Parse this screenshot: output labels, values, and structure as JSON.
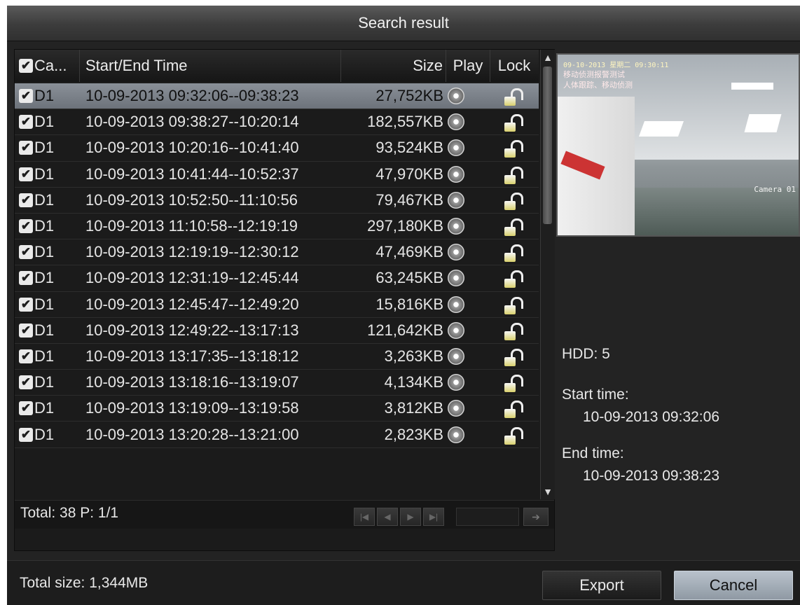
{
  "window": {
    "title": "Search result"
  },
  "table": {
    "headers": {
      "camera": "Ca...",
      "time": "Start/End Time",
      "size": "Size",
      "play": "Play",
      "lock": "Lock"
    },
    "rows": [
      {
        "checked": true,
        "camera": "D1",
        "time": "10-09-2013 09:32:06--09:38:23",
        "size": "27,752KB",
        "selected": true
      },
      {
        "checked": true,
        "camera": "D1",
        "time": "10-09-2013 09:38:27--10:20:14",
        "size": "182,557KB"
      },
      {
        "checked": true,
        "camera": "D1",
        "time": "10-09-2013 10:20:16--10:41:40",
        "size": "93,524KB"
      },
      {
        "checked": true,
        "camera": "D1",
        "time": "10-09-2013 10:41:44--10:52:37",
        "size": "47,970KB"
      },
      {
        "checked": true,
        "camera": "D1",
        "time": "10-09-2013 10:52:50--11:10:56",
        "size": "79,467KB"
      },
      {
        "checked": true,
        "camera": "D1",
        "time": "10-09-2013 11:10:58--12:19:19",
        "size": "297,180KB"
      },
      {
        "checked": true,
        "camera": "D1",
        "time": "10-09-2013 12:19:19--12:30:12",
        "size": "47,469KB"
      },
      {
        "checked": true,
        "camera": "D1",
        "time": "10-09-2013 12:31:19--12:45:44",
        "size": "63,245KB"
      },
      {
        "checked": true,
        "camera": "D1",
        "time": "10-09-2013 12:45:47--12:49:20",
        "size": "15,816KB"
      },
      {
        "checked": true,
        "camera": "D1",
        "time": "10-09-2013 12:49:22--13:17:13",
        "size": "121,642KB"
      },
      {
        "checked": true,
        "camera": "D1",
        "time": "10-09-2013 13:17:35--13:18:12",
        "size": "3,263KB"
      },
      {
        "checked": true,
        "camera": "D1",
        "time": "10-09-2013 13:18:16--13:19:07",
        "size": "4,134KB"
      },
      {
        "checked": true,
        "camera": "D1",
        "time": "10-09-2013 13:19:09--13:19:58",
        "size": "3,812KB"
      },
      {
        "checked": true,
        "camera": "D1",
        "time": "10-09-2013 13:20:28--13:21:00",
        "size": "2,823KB"
      }
    ]
  },
  "pager": {
    "total_text": "Total: 38  P: 1/1"
  },
  "preview": {
    "timestamp": "09-10-2013 星期二 09:30:11",
    "osd_line1": "移动侦测报警测试",
    "osd_line2": "人体跟踪、移动侦测",
    "camera_label": "Camera 01"
  },
  "details": {
    "hdd": "HDD: 5",
    "start_label": "Start time:",
    "start_value": "10-09-2013 09:32:06",
    "end_label": "End time:",
    "end_value": "10-09-2013 09:38:23"
  },
  "footer": {
    "total_size": "Total size: 1,344MB",
    "export_label": "Export",
    "cancel_label": "Cancel"
  },
  "icons": {
    "checkbox": "checkmark-icon",
    "play": "play-icon",
    "lock": "unlocked-padlock-icon"
  },
  "colors": {
    "selected_row": "#7c828a",
    "cancel_button": "#a4adb7",
    "background": "#232323"
  }
}
